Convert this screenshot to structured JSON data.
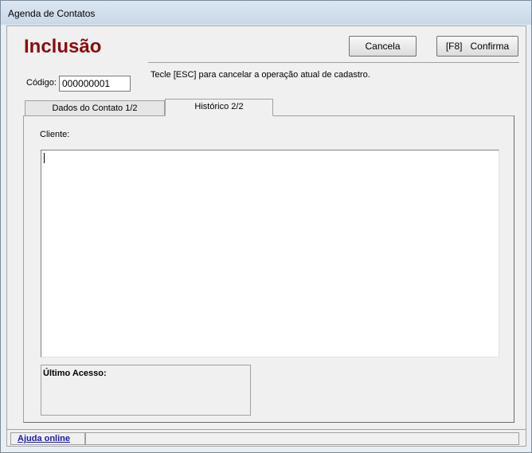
{
  "window": {
    "title": "Agenda de Contatos"
  },
  "header": {
    "heading": "Inclusão"
  },
  "toolbar": {
    "cancel_label": "Cancela",
    "confirm_label": "[F8]   Confirma"
  },
  "hint": "Tecle [ESC] para cancelar a operação atual de cadastro.",
  "code": {
    "label": "Código:",
    "value": "000000001"
  },
  "tabs": [
    {
      "label": "Dados do Contato 1/2"
    },
    {
      "label": "Histórico 2/2"
    }
  ],
  "page": {
    "client_label": "Cliente:",
    "last_access_label": "Último Acesso:"
  },
  "status": {
    "help_link": "Ajuda online"
  }
}
